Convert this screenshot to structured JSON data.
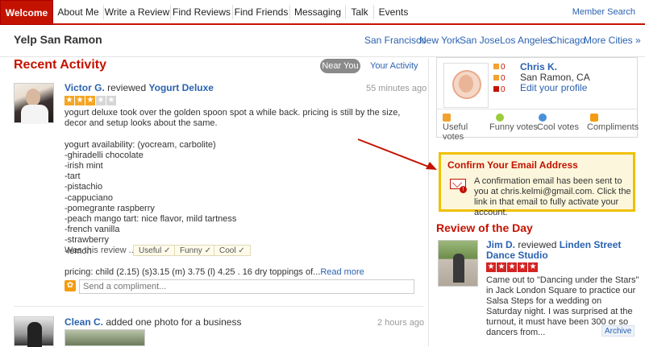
{
  "nav": {
    "tabs": [
      {
        "label": "Welcome",
        "active": true
      },
      {
        "label": "About Me"
      },
      {
        "label": "Write a Review"
      },
      {
        "label": "Find Reviews"
      },
      {
        "label": "Find Friends"
      },
      {
        "label": "Messaging"
      },
      {
        "label": "Talk"
      },
      {
        "label": "Events"
      }
    ],
    "member_search": "Member Search",
    "accent": "#c41200"
  },
  "citybar": {
    "title": "Yelp San Ramon",
    "cities": [
      "San Francisco",
      "New York",
      "San Jose",
      "Los Angeles",
      "Chicago",
      "More Cities »"
    ]
  },
  "activity": {
    "title": "Recent Activity",
    "filter_active": "Near You",
    "filter_other": "Your Activity",
    "review": {
      "user": "Victor G.",
      "action": " reviewed ",
      "business": "Yogurt Deluxe",
      "time": "55 minutes ago",
      "rating": 3,
      "lines": [
        "yogurt deluxe took over the golden spoon spot a while back. pricing is still by the size, decor and setup looks about the same.",
        "",
        "yogurt availability: (yocream, carbolite)",
        "-ghiradelli chocolate",
        "-irish mint",
        "-tart",
        "-pistachio",
        "-cappuciano",
        "-pomegrante raspberry",
        "-peach mango tart: nice flavor, mild tartness",
        "-french vanilla",
        "-strawberry",
        "-lemon",
        "",
        "pricing: child (2.15) (s)3.15  (m) 3.75  (l) 4.25 . 16 dry toppings of..."
      ],
      "read_more": "Read more",
      "was_this": "Was this review ...?",
      "useful": "Useful",
      "funny": "Funny",
      "cool": "Cool",
      "compliment_placeholder": "Send a compliment..."
    },
    "item2": {
      "user": "Clean C.",
      "action": " added one photo for a business",
      "time": "2 hours ago"
    }
  },
  "profile": {
    "name": "Chris K.",
    "location": "San Ramon, CA",
    "edit": "Edit your profile",
    "count1": "0",
    "count2": "0",
    "count3": "0",
    "votes": [
      {
        "label": "Useful votes",
        "color": "#f0a32f"
      },
      {
        "label": "Funny votes",
        "color": "#9ccc3c"
      },
      {
        "label": "Cool votes",
        "color": "#4a90d9"
      },
      {
        "label": "Compliments",
        "color": "#f39c12"
      }
    ]
  },
  "confirm": {
    "title": "Confirm Your Email Address",
    "text": "A confirmation email has been sent to you at chris.kelmi@gmail.com. Click the link in that email to fully activate your account."
  },
  "rotd": {
    "title": "Review of the Day",
    "user": "Jim D.",
    "action": " reviewed ",
    "business": "Linden Street Dance Studio",
    "rating": 5,
    "text": "Came out to \"Dancing under the Stars\" in Jack London Square to practice our Salsa Steps for a wedding on Saturday night. I was surprised at the turnout, it must have been 300 or so dancers from...",
    "archive": "Archive"
  }
}
